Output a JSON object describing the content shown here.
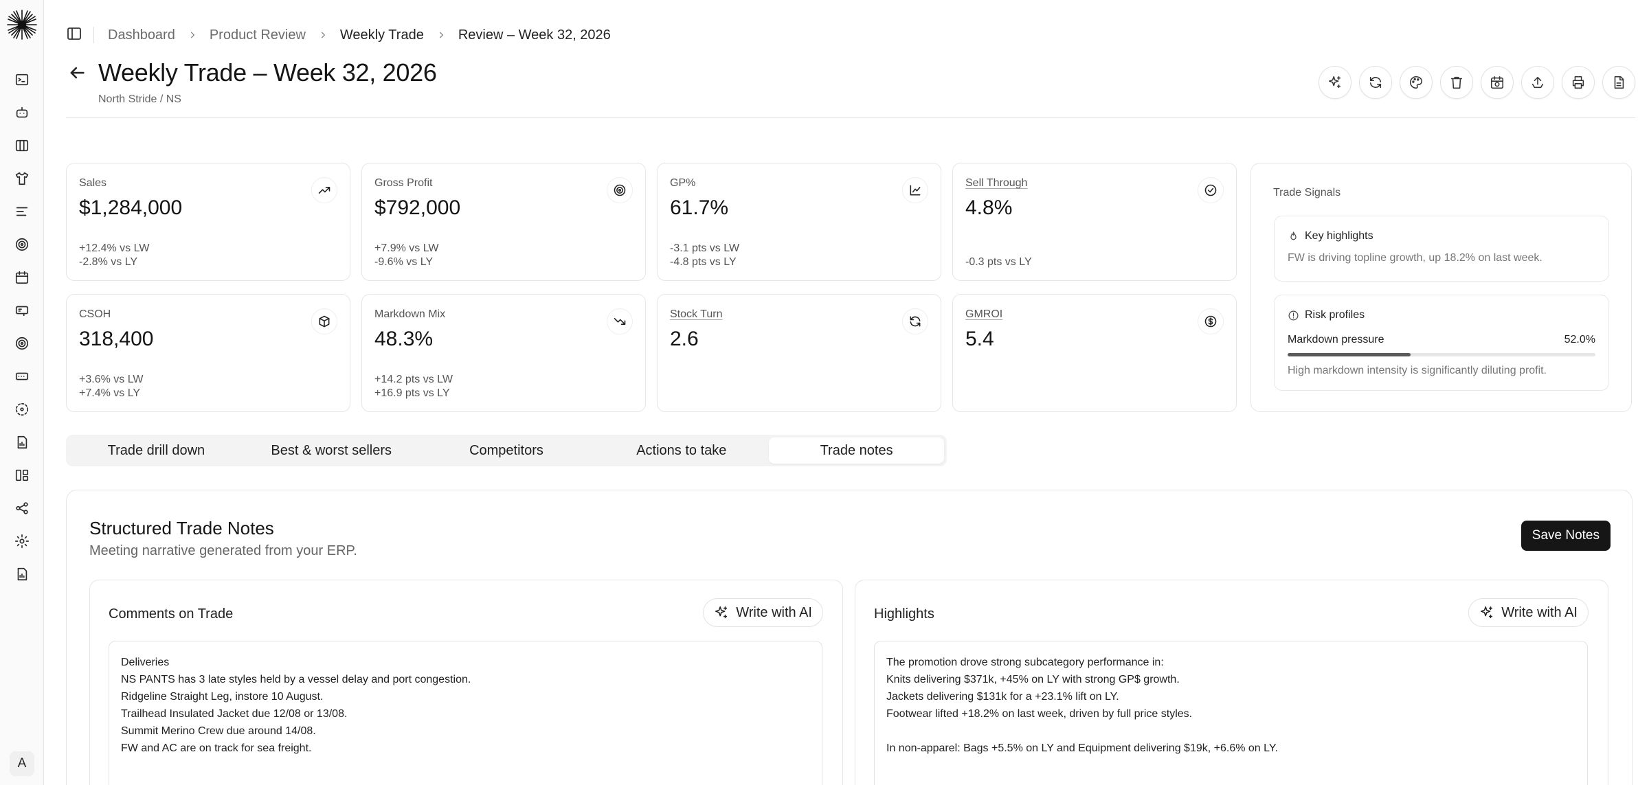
{
  "user": {
    "avatar_initial": "A"
  },
  "breadcrumb": [
    "Dashboard",
    "Product Review",
    "Weekly Trade",
    "Review – Week 32, 2026"
  ],
  "page": {
    "title": "Weekly Trade – Week 32, 2026",
    "subtitle": "North Stride / NS"
  },
  "toolbar": {
    "icons": [
      "sparkles-icon",
      "refresh-icon",
      "palette-icon",
      "trash-icon",
      "calendar-clock-icon",
      "upload-icon",
      "print-icon",
      "document-icon"
    ]
  },
  "kpis": [
    {
      "label": "Sales",
      "value": "$1,284,000",
      "deltas": [
        "+12.4% vs LW",
        "-2.8% vs LY"
      ],
      "icon": "trending-up-icon"
    },
    {
      "label": "Gross Profit",
      "value": "$792,000",
      "deltas": [
        "+7.9% vs LW",
        "-9.6% vs LY"
      ],
      "icon": "target-icon"
    },
    {
      "label": "GP%",
      "value": "61.7%",
      "deltas": [
        "-3.1 pts vs LW",
        "-4.8 pts vs LY"
      ],
      "icon": "line-chart-icon"
    },
    {
      "label": "Sell Through",
      "value": "4.8%",
      "deltas": [
        "",
        "-0.3 pts vs LY"
      ],
      "icon": "check-circle-icon"
    },
    {
      "label": "CSOH",
      "value": "318,400",
      "deltas": [
        "+3.6% vs LW",
        "+7.4% vs LY"
      ],
      "icon": "box-icon"
    },
    {
      "label": "Markdown Mix",
      "value": "48.3%",
      "deltas": [
        "+14.2 pts vs LW",
        "+16.9 pts vs LY"
      ],
      "icon": "trending-down-icon"
    },
    {
      "label": "Stock Turn",
      "value": "2.6",
      "deltas": [
        "",
        ""
      ],
      "icon": "refresh-icon"
    },
    {
      "label": "GMROI",
      "value": "5.4",
      "deltas": [
        "",
        ""
      ],
      "icon": "dollar-circle-icon"
    }
  ],
  "signals": {
    "title": "Trade Signals",
    "highlights": {
      "title": "Key highlights",
      "body": "FW is driving topline growth, up 18.2% on last week."
    },
    "risk": {
      "title": "Risk profiles",
      "metric_label": "Markdown pressure",
      "metric_value": "52.0%",
      "fill_percent": 40,
      "body": "High markdown intensity is significantly diluting profit."
    }
  },
  "tabs": [
    "Trade drill down",
    "Best & worst sellers",
    "Competitors",
    "Actions to take",
    "Trade notes"
  ],
  "notes": {
    "title": "Structured Trade Notes",
    "subtitle": "Meeting narrative generated from your ERP.",
    "save_label": "Save Notes",
    "ai_label": "Write with AI",
    "comments": {
      "title": "Comments on Trade",
      "lines": [
        "Deliveries",
        "NS PANTS has 3 late styles held by a vessel delay and port congestion.",
        "Ridgeline Straight Leg, instore 10 August.",
        "Trailhead Insulated Jacket due 12/08 or 13/08.",
        "Summit Merino Crew due around 14/08.",
        "FW and AC are on track for sea freight."
      ]
    },
    "highlights": {
      "title": "Highlights",
      "lines": [
        "The promotion drove strong subcategory performance in:",
        "Knits delivering $371k, +45% on LY with strong GP$ growth.",
        "Jackets delivering $131k for a +23.1% lift on LY.",
        "Footwear lifted +18.2% on last week, driven by full price styles.",
        "",
        "In non-apparel: Bags +5.5% on LY and Equipment delivering $19k, +6.6% on LY."
      ]
    }
  }
}
